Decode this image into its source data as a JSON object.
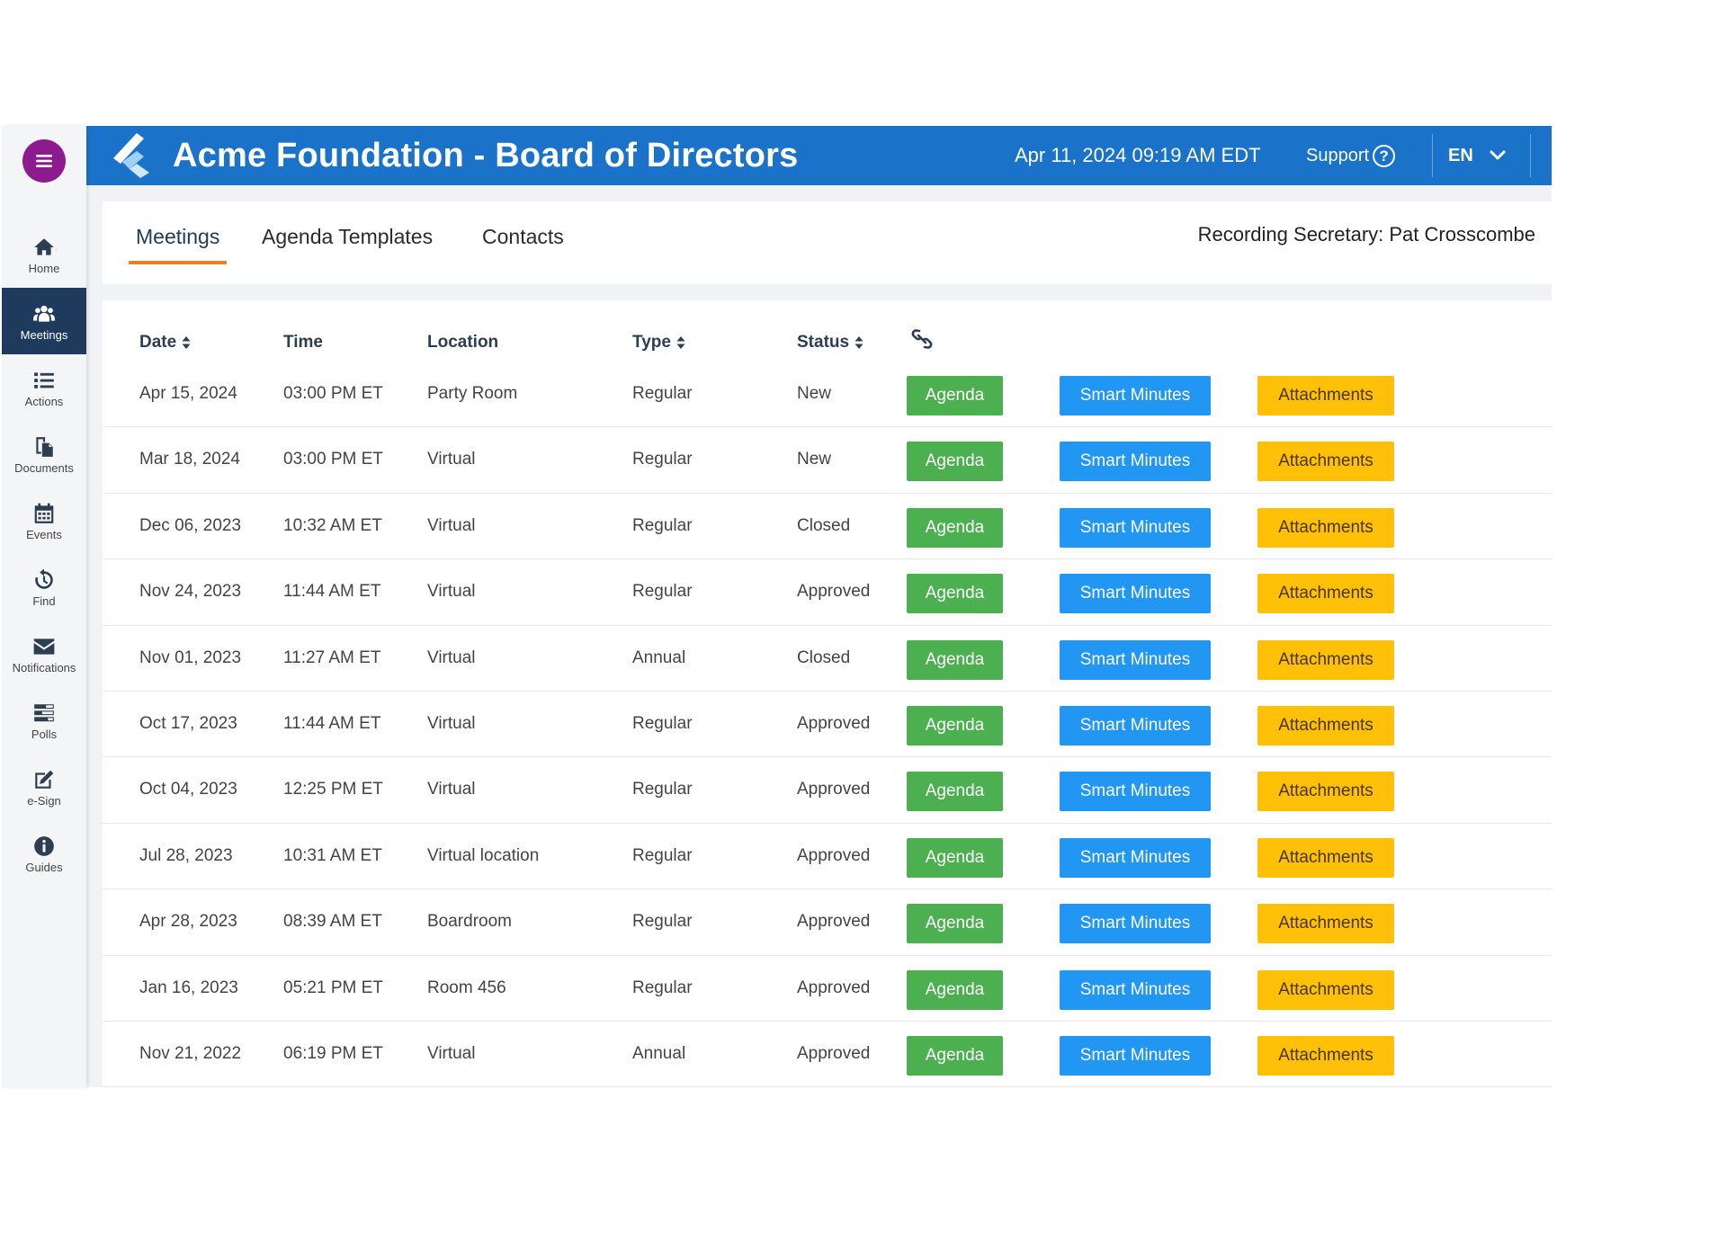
{
  "header": {
    "title": "Acme Foundation - Board of Directors",
    "datetime": "Apr 11, 2024 09:19 AM  EDT",
    "support_label": "Support",
    "help_glyph": "?",
    "language": "EN"
  },
  "colors": {
    "header_bg": "#1a73c8",
    "menu_button": "#8e1a8f",
    "active_nav": "#1e3a5c",
    "tab_underline": "#f07c1e",
    "agenda": "#4caf50",
    "smart_minutes": "#2196f3",
    "attachments": "#ffc107"
  },
  "sidebar": {
    "menu_icon": "hamburger-icon",
    "items": [
      {
        "label": "Home",
        "icon": "home-icon",
        "active": false
      },
      {
        "label": "Meetings",
        "icon": "people-icon",
        "active": true
      },
      {
        "label": "Actions",
        "icon": "list-icon",
        "active": false
      },
      {
        "label": "Documents",
        "icon": "documents-icon",
        "active": false
      },
      {
        "label": "Events",
        "icon": "calendar-icon",
        "active": false
      },
      {
        "label": "Find",
        "icon": "history-icon",
        "active": false
      },
      {
        "label": "Notifications",
        "icon": "envelope-icon",
        "active": false
      },
      {
        "label": "Polls",
        "icon": "polls-icon",
        "active": false
      },
      {
        "label": "e-Sign",
        "icon": "edit-icon",
        "active": false
      },
      {
        "label": "Guides",
        "icon": "info-icon",
        "active": false
      }
    ]
  },
  "tabs": [
    {
      "label": "Meetings",
      "active": true
    },
    {
      "label": "Agenda Templates",
      "active": false
    },
    {
      "label": "Contacts",
      "active": false
    }
  ],
  "secretary": "Recording Secretary: Pat Crosscombe",
  "table": {
    "headers": {
      "date": "Date",
      "time": "Time",
      "location": "Location",
      "type": "Type",
      "status": "Status",
      "link_icon": "link-icon"
    },
    "buttons": {
      "agenda": "Agenda",
      "smart_minutes": "Smart Minutes",
      "attachments": "Attachments"
    },
    "rows": [
      {
        "date": "Apr 15, 2024",
        "time": "03:00 PM ET",
        "location": "Party Room",
        "type": "Regular",
        "status": "New",
        "external_link": true
      },
      {
        "date": "Mar 18, 2024",
        "time": "03:00 PM ET",
        "location": "Virtual",
        "type": "Regular",
        "status": "New",
        "external_link": false
      },
      {
        "date": "Dec 06, 2023",
        "time": "10:32 AM ET",
        "location": "Virtual",
        "type": "Regular",
        "status": "Closed",
        "external_link": false
      },
      {
        "date": "Nov 24, 2023",
        "time": "11:44 AM ET",
        "location": "Virtual",
        "type": "Regular",
        "status": "Approved",
        "external_link": false
      },
      {
        "date": "Nov 01, 2023",
        "time": "11:27 AM ET",
        "location": "Virtual",
        "type": "Annual",
        "status": "Closed",
        "external_link": false
      },
      {
        "date": "Oct 17, 2023",
        "time": "11:44 AM ET",
        "location": "Virtual",
        "type": "Regular",
        "status": "Approved",
        "external_link": false
      },
      {
        "date": "Oct 04, 2023",
        "time": "12:25 PM ET",
        "location": "Virtual",
        "type": "Regular",
        "status": "Approved",
        "external_link": false
      },
      {
        "date": "Jul 28, 2023",
        "time": "10:31 AM ET",
        "location": "Virtual location",
        "type": "Regular",
        "status": "Approved",
        "external_link": false
      },
      {
        "date": "Apr 28, 2023",
        "time": "08:39 AM ET",
        "location": "Boardroom",
        "type": "Regular",
        "status": "Approved",
        "external_link": false
      },
      {
        "date": "Jan 16, 2023",
        "time": "05:21 PM ET",
        "location": "Room 456",
        "type": "Regular",
        "status": "Approved",
        "external_link": false
      },
      {
        "date": "Nov 21, 2022",
        "time": "06:19 PM ET",
        "location": "Virtual",
        "type": "Annual",
        "status": "Approved",
        "external_link": false
      }
    ]
  }
}
